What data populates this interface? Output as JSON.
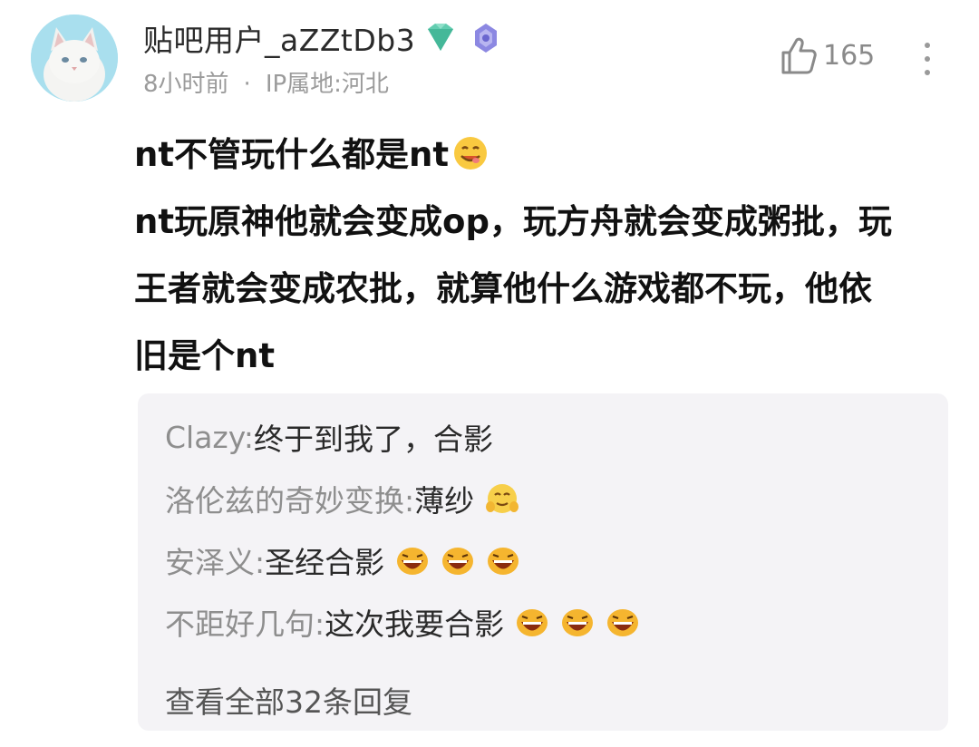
{
  "post": {
    "username": "贴吧用户_aZZtDb3",
    "time": "8小时前",
    "separator": "·",
    "ip_location": "IP属地:河北",
    "like_count": "165",
    "content_lines": [
      "nt不管玩什么都是nt",
      "nt玩原神他就会变成op，玩方舟就会变成粥批，玩",
      "王者就会变成农批，就算他什么游戏都不玩，他依",
      "旧是个nt"
    ]
  },
  "replies": [
    {
      "name": "Clazy:",
      "text": " 终于到我了，合影",
      "emoji_count": 0
    },
    {
      "name": "洛伦兹的奇妙变换:",
      "text": " 薄纱",
      "emoji_count": 1
    },
    {
      "name": "安泽义:",
      "text": " 圣经合影",
      "emoji_count": 3
    },
    {
      "name": "不距好几句:",
      "text": " 这次我要合影",
      "emoji_count": 3
    }
  ],
  "view_all": "查看全部32条回复",
  "icons": {
    "avatar": "white-cat-avatar",
    "badge1": "green-diamond-icon",
    "badge2": "purple-level-icon",
    "like": "thumbs-up-icon",
    "more": "more-vertical-icon"
  },
  "colors": {
    "reply_bg": "#f4f3f6",
    "meta_gray": "#9b9b9b",
    "badge_green": "#5cc8a8",
    "badge_purple": "#7b78d8"
  }
}
